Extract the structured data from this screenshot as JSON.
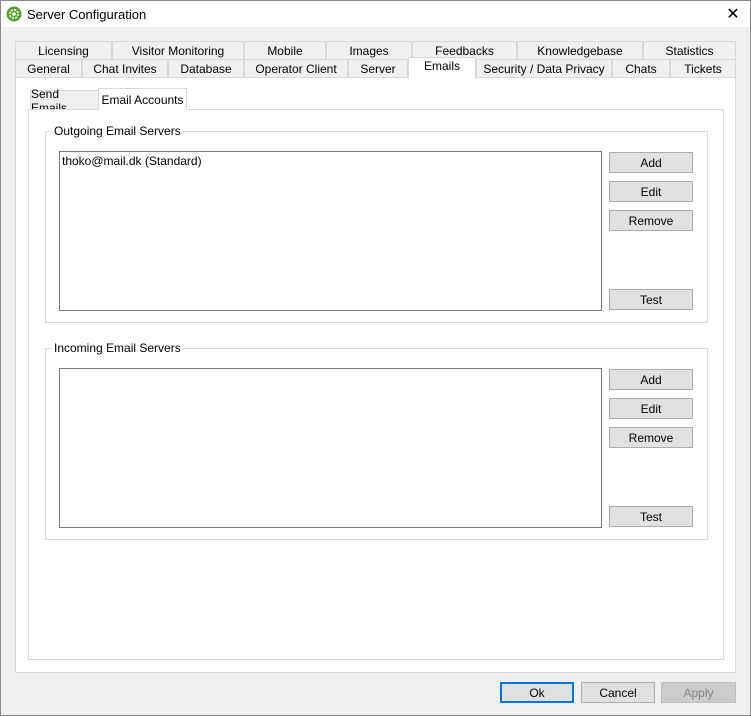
{
  "window": {
    "title": "Server Configuration"
  },
  "tabs_row1": [
    "Licensing",
    "Visitor Monitoring",
    "Mobile",
    "Images",
    "Feedbacks",
    "Knowledgebase",
    "Statistics"
  ],
  "tabs_row2": [
    "General",
    "Chat Invites",
    "Database",
    "Operator Client",
    "Server",
    "Emails",
    "Security / Data Privacy",
    "Chats",
    "Tickets"
  ],
  "active_tab": "Emails",
  "subtabs": [
    "Send Emails",
    "Email Accounts"
  ],
  "active_subtab": "Email Accounts",
  "outgoing": {
    "label": "Outgoing Email Servers",
    "items": [
      "thoko@mail.dk (Standard)"
    ],
    "add": "Add",
    "edit": "Edit",
    "remove": "Remove",
    "test": "Test"
  },
  "incoming": {
    "label": "Incoming Email Servers",
    "items": [],
    "add": "Add",
    "edit": "Edit",
    "remove": "Remove",
    "test": "Test"
  },
  "footer": {
    "ok": "Ok",
    "cancel": "Cancel",
    "apply": "Apply"
  },
  "colors": {
    "accent": "#0078d7",
    "app_icon": "#5aa02c"
  },
  "icons": {
    "app": "gear-icon",
    "close": "close-icon"
  }
}
